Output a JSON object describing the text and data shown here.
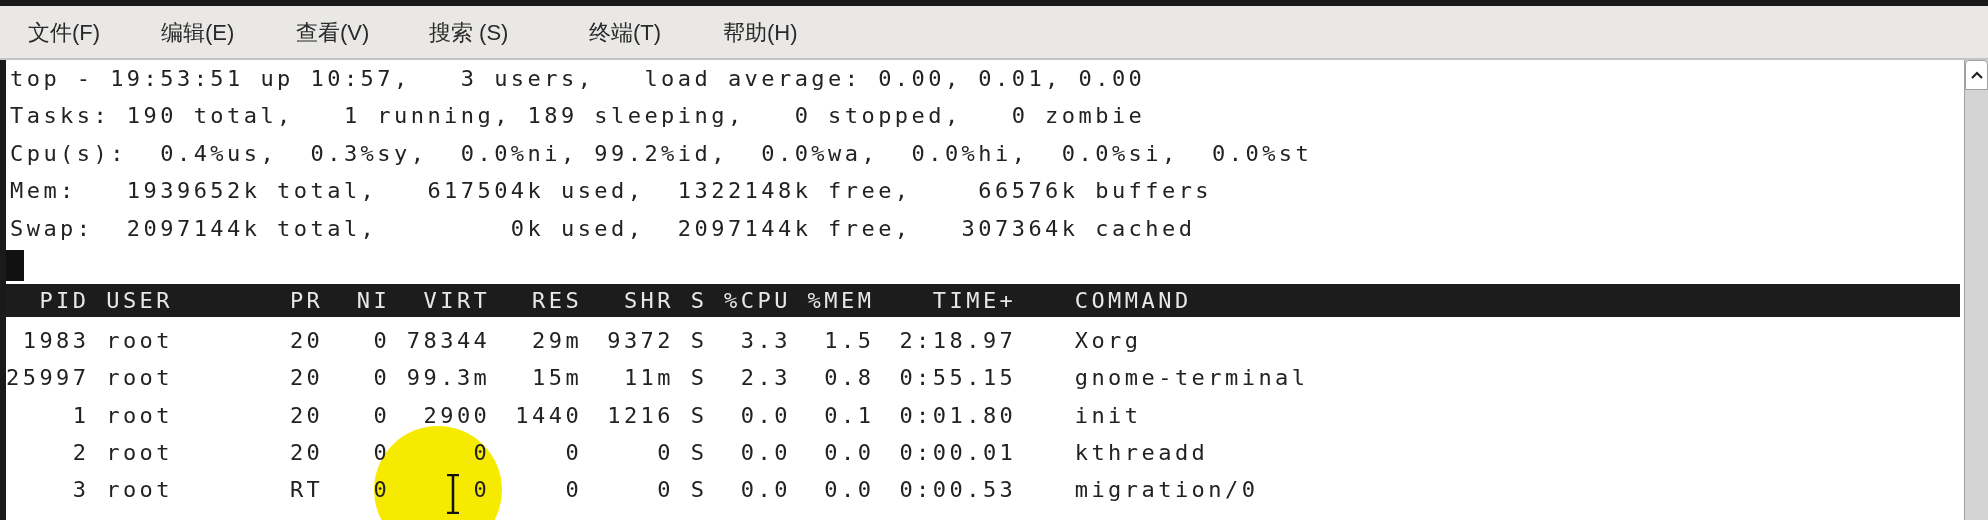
{
  "menu": [
    {
      "label": "文件(F)"
    },
    {
      "label": "编辑(E)"
    },
    {
      "label": "查看(V)"
    },
    {
      "label": "搜索 (S)"
    },
    {
      "label": "终端(T)"
    },
    {
      "label": "帮助(H)"
    }
  ],
  "summary_lines": [
    "top - 19:53:51 up 10:57,   3 users,   load average: 0.00, 0.01, 0.00",
    "Tasks: 190 total,   1 running, 189 sleeping,   0 stopped,   0 zombie",
    "Cpu(s):  0.4%us,  0.3%sy,  0.0%ni, 99.2%id,  0.0%wa,  0.0%hi,  0.0%si,  0.0%st",
    "Mem:   1939652k total,   617504k used,  1322148k free,    66576k buffers",
    "Swap:  2097144k total,        0k used,  2097144k free,   307364k cached"
  ],
  "table": {
    "columns": [
      "PID",
      "USER",
      "PR",
      "NI",
      "VIRT",
      "RES",
      "SHR",
      "S",
      "%CPU",
      "%MEM",
      "TIME+",
      "COMMAND"
    ],
    "rows": [
      [
        "1983",
        "root",
        "20",
        "0",
        "78344",
        "29m",
        "9372",
        "S",
        "3.3",
        "1.5",
        "2:18.97",
        "Xorg"
      ],
      [
        "25997",
        "root",
        "20",
        "0",
        "99.3m",
        "15m",
        "11m",
        "S",
        "2.3",
        "0.8",
        "0:55.15",
        "gnome-terminal"
      ],
      [
        "1",
        "root",
        "20",
        "0",
        "2900",
        "1440",
        "1216",
        "S",
        "0.0",
        "0.1",
        "0:01.80",
        "init"
      ],
      [
        "2",
        "root",
        "20",
        "0",
        "0",
        "0",
        "0",
        "S",
        "0.0",
        "0.0",
        "0:00.01",
        "kthreadd"
      ],
      [
        "3",
        "root",
        "RT",
        "0",
        "0",
        "0",
        "0",
        "S",
        "0.0",
        "0.0",
        "0:00.53",
        "migration/0"
      ]
    ]
  }
}
